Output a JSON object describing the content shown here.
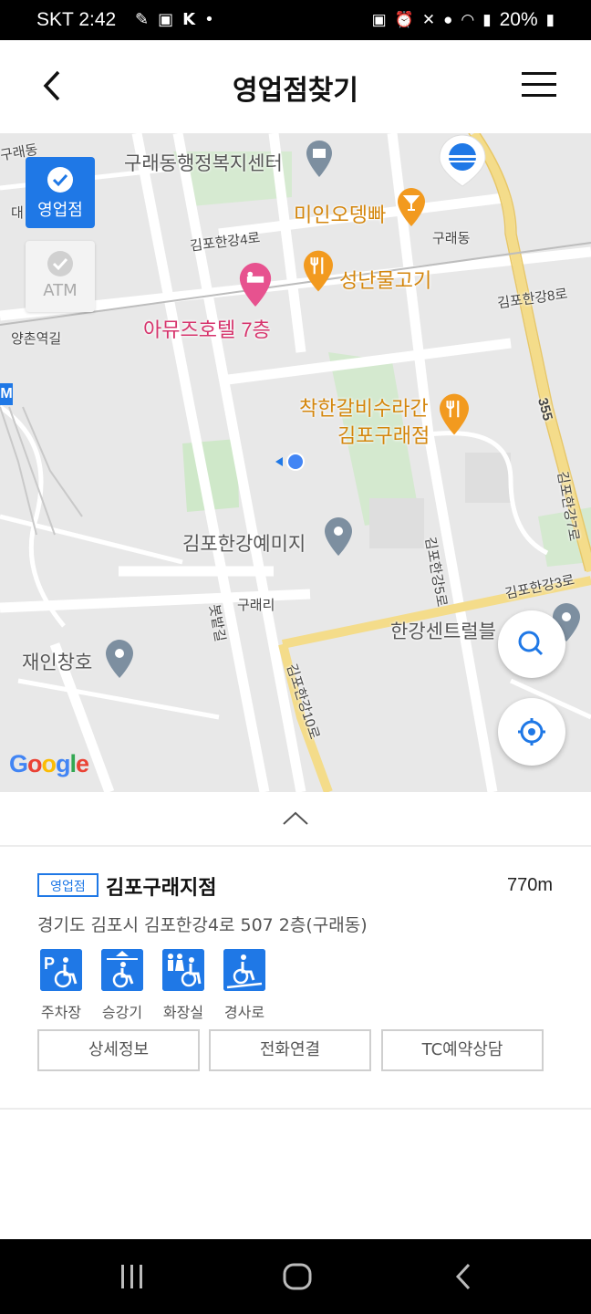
{
  "status_bar": {
    "carrier": "SKT",
    "time": "2:42",
    "battery": "20%",
    "left_icons": [
      "link-icon",
      "image-icon",
      "k-app-icon",
      "dot-icon"
    ],
    "right_icons": [
      "work-profile-icon",
      "alarm-icon",
      "mute-icon",
      "location-icon",
      "wifi-icon",
      "signal-icon",
      "battery-icon"
    ]
  },
  "header": {
    "title": "영업점찾기"
  },
  "filters": {
    "branch": "영업점",
    "atm": "ATM"
  },
  "map": {
    "labels": {
      "welfare_center": "구래동행정복지센터",
      "cafe": "미인오뎅빠",
      "road_4": "김포한강4로",
      "guraedong": "구래동",
      "restaurant_fish": "성난물고기",
      "road_8": "김포한강8로",
      "hotel": "아뮤즈호텔 7층",
      "yangchon": "양촌역길",
      "galbi_1": "착한갈비수라간",
      "galbi_2": "김포구래점",
      "route_355": "355",
      "road_7": "김포한강7로",
      "yemiji": "김포한강예미지",
      "road_5": "김포한강5로",
      "road_3": "김포한강3로",
      "gurae_ri": "구래리",
      "budgil": "봇밭길",
      "central": "한강센트럴블",
      "jaein": "재인창호",
      "road_10": "김포한강10로",
      "edge_gurae": "구래동",
      "edge_dae": "대",
      "metro": "M"
    },
    "attribution": "Google"
  },
  "branch": {
    "badge": "영업점",
    "name": "김포구래지점",
    "distance": "770m",
    "address": "경기도 김포시 김포한강4로 507 2층(구래동)",
    "facilities": [
      {
        "label": "주차장",
        "icon": "accessible-parking-icon"
      },
      {
        "label": "승강기",
        "icon": "accessible-elevator-icon"
      },
      {
        "label": "화장실",
        "icon": "accessible-restroom-icon"
      },
      {
        "label": "경사로",
        "icon": "accessible-ramp-icon"
      }
    ],
    "buttons": {
      "detail": "상세정보",
      "call": "전화연결",
      "tc": "TC예약상담"
    }
  },
  "colors": {
    "accent": "#1f78e6",
    "map_bg": "#e8e8e8",
    "road_yellow": "#f4dc8a",
    "park_green": "#cfe8c9"
  }
}
